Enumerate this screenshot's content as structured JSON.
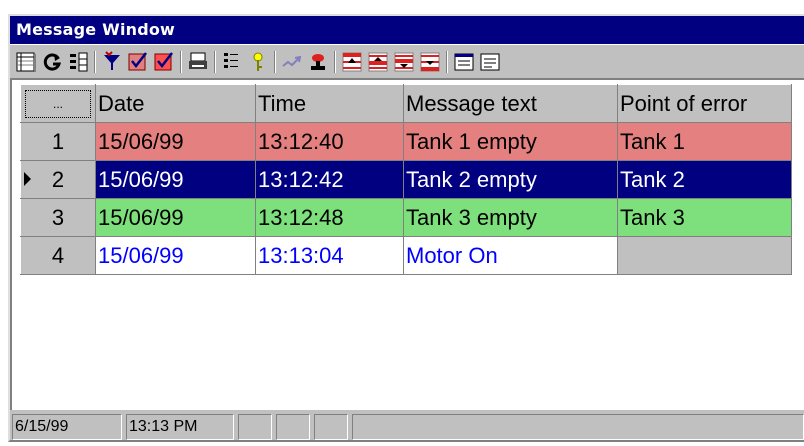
{
  "window": {
    "title": "Message Window"
  },
  "toolbar": {
    "buttons": [
      {
        "icon": "message-list-icon"
      },
      {
        "icon": "refresh-icon"
      },
      {
        "icon": "list-view-icon"
      },
      {
        "icon": "filter-icon"
      },
      {
        "icon": "check-select-icon"
      },
      {
        "icon": "check-select-red-icon"
      },
      {
        "icon": "print-icon"
      },
      {
        "icon": "properties-icon"
      },
      {
        "icon": "key-icon"
      },
      {
        "icon": "acknowledge-icon"
      },
      {
        "icon": "horn-icon"
      },
      {
        "icon": "first-message-icon"
      },
      {
        "icon": "previous-message-icon"
      },
      {
        "icon": "next-message-icon"
      },
      {
        "icon": "last-message-icon"
      },
      {
        "icon": "info-text-icon"
      },
      {
        "icon": "comment-icon"
      }
    ]
  },
  "table": {
    "corner_label": "...",
    "columns": [
      "Date",
      "Time",
      "Message text",
      "Point of error"
    ],
    "rows": [
      {
        "num": "1",
        "date": "15/06/99",
        "time": "13:12:40",
        "message": "Tank 1 empty",
        "point": "Tank 1",
        "color": "red",
        "selected": false
      },
      {
        "num": "2",
        "date": "15/06/99",
        "time": "13:12:42",
        "message": "Tank 2 empty",
        "point": "Tank 2",
        "color": "selected",
        "selected": true
      },
      {
        "num": "3",
        "date": "15/06/99",
        "time": "13:12:48",
        "message": "Tank 3 empty",
        "point": "Tank 3",
        "color": "green",
        "selected": false
      },
      {
        "num": "4",
        "date": "15/06/99",
        "time": "13:13:04",
        "message": "Motor On",
        "point": "",
        "color": "blue",
        "selected": false
      }
    ]
  },
  "statusbar": {
    "date": "6/15/99",
    "time": "13:13 PM"
  },
  "colors": {
    "title_bar": "#000080",
    "row_red": "#e48080",
    "row_selected": "#000080",
    "row_green": "#7de07d",
    "text_blue": "#0000ff"
  }
}
